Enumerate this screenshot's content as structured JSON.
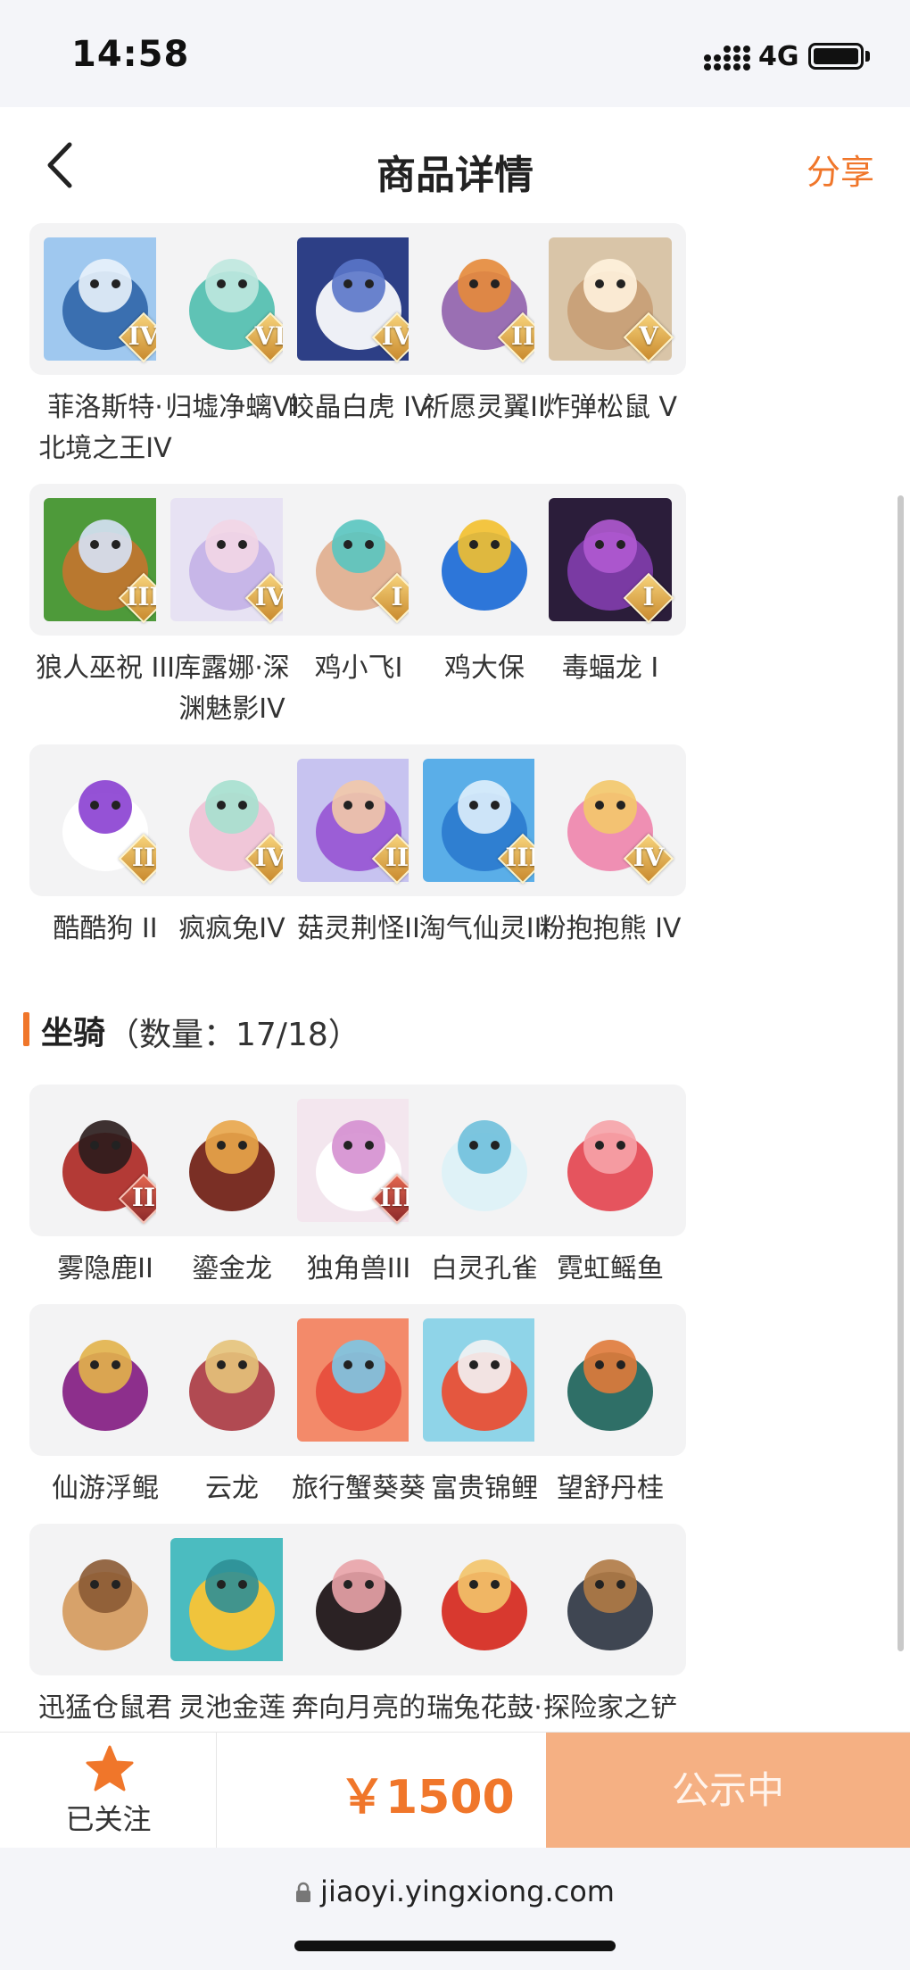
{
  "status_bar": {
    "time": "14:58",
    "network": "4G"
  },
  "header": {
    "title": "商品详情",
    "share_label": "分享"
  },
  "pets": [
    {
      "name": "菲洛斯特·\n北境之王IV",
      "rank": "IV",
      "icon": "frost-king-icon"
    },
    {
      "name": "归墟净螭VI",
      "rank": "VI",
      "icon": "jade-dragon-icon"
    },
    {
      "name": "皎晶白虎 IV",
      "rank": "IV",
      "icon": "white-tiger-icon"
    },
    {
      "name": "祈愿灵翼II",
      "rank": "II",
      "icon": "wing-bird-icon"
    },
    {
      "name": "炸弹松鼠 V",
      "rank": "V",
      "icon": "bomb-squirrel-icon"
    },
    {
      "name": "狼人巫祝 III",
      "rank": "III",
      "icon": "werewolf-shaman-icon"
    },
    {
      "name": "库露娜·深\n渊魅影IV",
      "rank": "IV",
      "icon": "abyss-phantom-icon"
    },
    {
      "name": "鸡小飞I",
      "rank": "I",
      "icon": "small-chick-icon"
    },
    {
      "name": "鸡大保",
      "rank": "",
      "icon": "big-chick-icon"
    },
    {
      "name": "毒蝠龙 I",
      "rank": "I",
      "icon": "poison-bat-dragon-icon"
    },
    {
      "name": "酷酷狗 II",
      "rank": "II",
      "icon": "cool-dog-icon"
    },
    {
      "name": "疯疯兔IV",
      "rank": "IV",
      "icon": "crazy-rabbit-icon"
    },
    {
      "name": "菇灵荆怪II",
      "rank": "II",
      "icon": "mushroom-sprite-icon"
    },
    {
      "name": "淘气仙灵III",
      "rank": "III",
      "icon": "naughty-fairy-icon"
    },
    {
      "name": "粉抱抱熊 IV",
      "rank": "IV",
      "icon": "pink-bear-icon"
    }
  ],
  "mounts_section": {
    "title": "坐骑",
    "count_text": "（数量：17/18）"
  },
  "mounts": [
    {
      "name": "雾隐鹿II",
      "rank": "II",
      "icon": "mist-deer-icon"
    },
    {
      "name": "鎏金龙",
      "rank": "",
      "icon": "gilded-dragon-icon"
    },
    {
      "name": "独角兽III",
      "rank": "III",
      "icon": "unicorn-icon"
    },
    {
      "name": "白灵孔雀",
      "rank": "",
      "icon": "white-peacock-icon"
    },
    {
      "name": "霓虹鳐鱼",
      "rank": "",
      "icon": "neon-ray-icon"
    },
    {
      "name": "仙游浮鲲",
      "rank": "",
      "icon": "floating-kun-icon"
    },
    {
      "name": "云龙",
      "rank": "",
      "icon": "cloud-dragon-icon"
    },
    {
      "name": "旅行蟹葵葵",
      "rank": "",
      "icon": "travel-crab-icon"
    },
    {
      "name": "富贵锦鲤",
      "rank": "",
      "icon": "koi-fish-icon"
    },
    {
      "name": "望舒丹桂",
      "rank": "",
      "icon": "osmanthus-swing-icon"
    },
    {
      "name": "迅猛仓鼠君",
      "rank": "",
      "icon": "hamster-icon"
    },
    {
      "name": "灵池金莲",
      "rank": "",
      "icon": "golden-lotus-icon"
    },
    {
      "name": "奔向月亮的\n猪猪侠",
      "rank": "",
      "icon": "moon-pig-icon"
    },
    {
      "name": "瑞兔花鼓·\n春",
      "rank": "",
      "icon": "rabbit-drum-icon"
    },
    {
      "name": "探险家之铲",
      "rank": "",
      "icon": "explorer-shovel-icon"
    }
  ],
  "footer": {
    "follow_label": "已关注",
    "price": "￥1500",
    "status_label": "公示中"
  },
  "browser": {
    "url": "jiaoyi.yingxiong.com"
  },
  "colors": {
    "accent": "#f0762a",
    "status_button": "#f5b083"
  }
}
